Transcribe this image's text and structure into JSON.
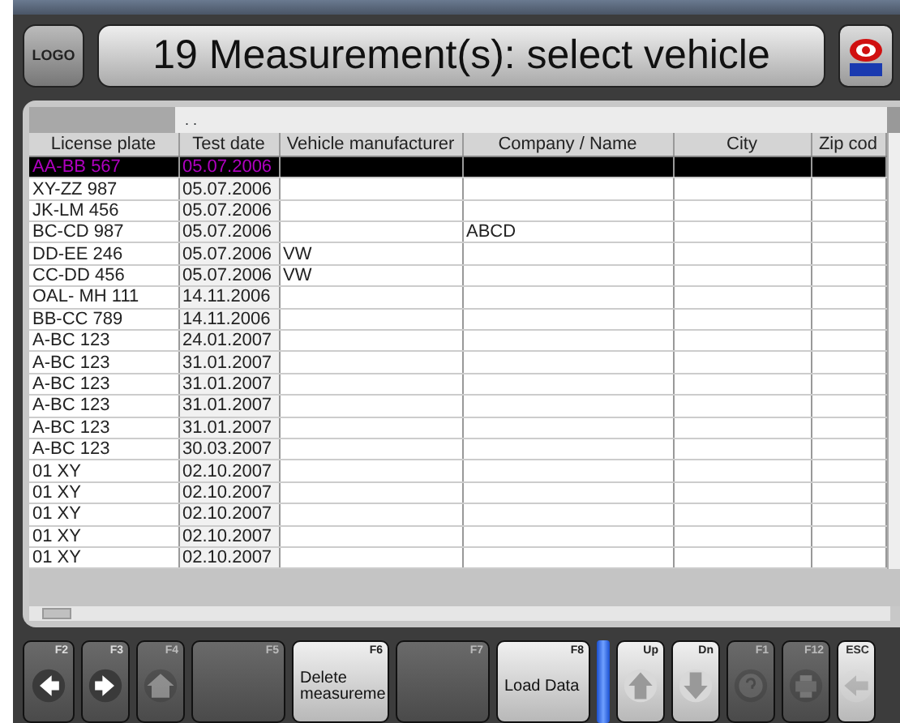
{
  "window": {
    "title": "19 Measurement(s): select vehicle",
    "logo_button": "LOGO"
  },
  "table": {
    "filter_text": ". .",
    "columns": [
      "License plate",
      "Test date",
      "Vehicle manufacturer",
      "Company / Name",
      "City",
      "Zip cod"
    ],
    "rows": [
      {
        "plate": "AA-BB 567",
        "date": "05.07.2006",
        "selected": true
      },
      {
        "plate": "XY-ZZ 987",
        "date": "05.07.2006",
        "selected": false
      },
      {
        "plate": "JK-LM 456",
        "date": "05.07.2006",
        "selected": false
      },
      {
        "plate": "BC-CD 987",
        "date": "05.07.2006",
        "company": "ABCD",
        "selected": false
      },
      {
        "plate": "DD-EE 246",
        "date": "05.07.2006",
        "manufacturer": "VW",
        "selected": false
      },
      {
        "plate": "CC-DD 456",
        "date": "05.07.2006",
        "manufacturer": "VW",
        "selected": false
      },
      {
        "plate": "OAL- MH 111",
        "date": "14.11.2006",
        "selected": false
      },
      {
        "plate": "BB-CC 789",
        "date": "14.11.2006",
        "selected": false
      },
      {
        "plate": "A-BC 123",
        "date": "24.01.2007",
        "selected": false
      },
      {
        "plate": "A-BC 123",
        "date": "31.01.2007",
        "selected": false
      },
      {
        "plate": "A-BC 123",
        "date": "31.01.2007",
        "selected": false
      },
      {
        "plate": "A-BC 123",
        "date": "31.01.2007",
        "selected": false
      },
      {
        "plate": "A-BC 123",
        "date": "31.01.2007",
        "selected": false
      },
      {
        "plate": "A-BC 123",
        "date": "30.03.2007",
        "selected": false
      },
      {
        "plate": "01 XY",
        "date": "02.10.2007",
        "selected": false
      },
      {
        "plate": "01 XY",
        "date": "02.10.2007",
        "selected": false
      },
      {
        "plate": "01 XY",
        "date": "02.10.2007",
        "selected": false
      },
      {
        "plate": "01 XY",
        "date": "02.10.2007",
        "selected": false
      },
      {
        "plate": "01 XY",
        "date": "02.10.2007",
        "selected": false
      }
    ]
  },
  "keys": [
    {
      "key": "F2",
      "kind": "icon",
      "lit": false,
      "disabled": false
    },
    {
      "key": "F3",
      "kind": "icon",
      "lit": false,
      "disabled": false
    },
    {
      "key": "F4",
      "kind": "icon",
      "lit": false,
      "disabled": true
    },
    {
      "key": "F5",
      "kind": "blank",
      "lit": false,
      "disabled": true
    },
    {
      "key": "F6",
      "kind": "text",
      "label": "Delete measureme",
      "lit": true,
      "disabled": false
    },
    {
      "key": "F7",
      "kind": "blank",
      "lit": false,
      "disabled": true
    },
    {
      "key": "F8",
      "kind": "text",
      "label": "Load Data",
      "lit": true,
      "disabled": false
    },
    {
      "kind": "indicator"
    },
    {
      "key": "Up",
      "kind": "icon",
      "lit": true,
      "disabled": false
    },
    {
      "key": "Dn",
      "kind": "icon",
      "lit": true,
      "disabled": false
    },
    {
      "key": "F1",
      "kind": "icon",
      "lit": false,
      "disabled": true
    },
    {
      "key": "F12",
      "kind": "icon",
      "lit": false,
      "disabled": true
    },
    {
      "key": "ESC",
      "kind": "icon",
      "lit": true,
      "disabled": true
    }
  ]
}
